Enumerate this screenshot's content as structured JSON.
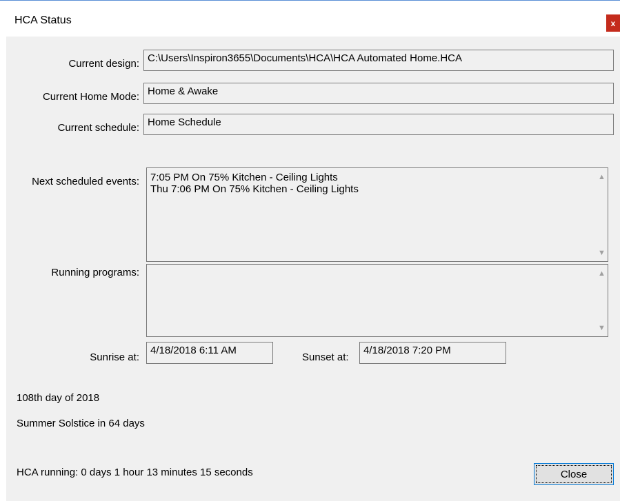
{
  "window": {
    "title": "HCA Status",
    "close_glyph": "x"
  },
  "fields": {
    "current_design": {
      "label": "Current design:",
      "value": "C:\\Users\\Inspiron3655\\Documents\\HCA\\HCA Automated Home.HCA"
    },
    "current_home_mode": {
      "label": "Current Home Mode:",
      "value": "Home & Awake"
    },
    "current_schedule": {
      "label": "Current schedule:",
      "value": "Home Schedule"
    }
  },
  "next_events": {
    "label": "Next scheduled events:",
    "items": [
      "7:05 PM  On 75%  Kitchen - Ceiling Lights",
      "Thu 7:06 PM  On 75%  Kitchen - Ceiling Lights"
    ]
  },
  "running_programs": {
    "label": "Running programs:",
    "items": []
  },
  "sun": {
    "sunrise_label": "Sunrise at:",
    "sunrise_value": "4/18/2018 6:11 AM",
    "sunset_label": "Sunset at:",
    "sunset_value": "4/18/2018 7:20 PM"
  },
  "info": {
    "day_of_year": "108th day of 2018",
    "solstice": "Summer Solstice in 64 days",
    "running_time": "HCA running: 0 days 1 hour 13 minutes 15 seconds"
  },
  "buttons": {
    "close_label": "Close"
  },
  "icons": {
    "scroll_up": "▲",
    "scroll_down": "▼"
  }
}
